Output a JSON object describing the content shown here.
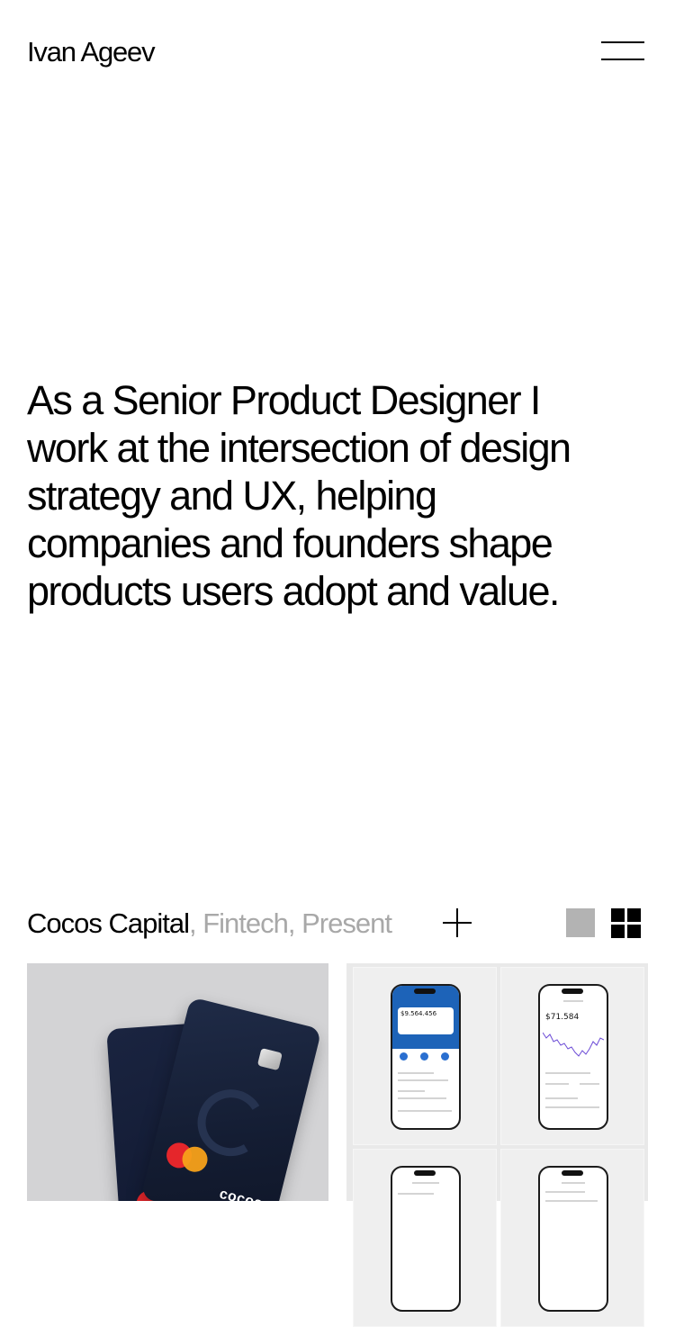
{
  "header": {
    "brand": "Ivan Ageev",
    "menu_icon": "hamburger-icon"
  },
  "hero": {
    "line1": "As a Senior Product Designer I",
    "line2": "work at the intersection of design",
    "line3": "strategy and UX, helping",
    "line4": "companies and founders shape",
    "line5": "products users adopt and value."
  },
  "project": {
    "name": "Cocos Capital",
    "sep1": ", ",
    "category": "Fintech,",
    "sep2": " ",
    "period": "Present",
    "expand_icon": "plus-icon",
    "view_single_icon": "single-view-icon",
    "view_grid_icon": "grid-view-icon"
  },
  "gallery": {
    "card_brand": "cocos",
    "screens": [
      {
        "balance": "$9.564.456",
        "screen": "home"
      },
      {
        "balance": "$71.584",
        "screen": "portfolio"
      }
    ]
  },
  "colors": {
    "text": "#000000",
    "muted": "#a8a8a8",
    "tile_left_bg": "#d3d3d5",
    "tile_right_bg": "#e9e9e9",
    "view_single_active": "#b3b3b3",
    "card_navy": "#1a2440",
    "app_blue": "#1d63b8"
  }
}
